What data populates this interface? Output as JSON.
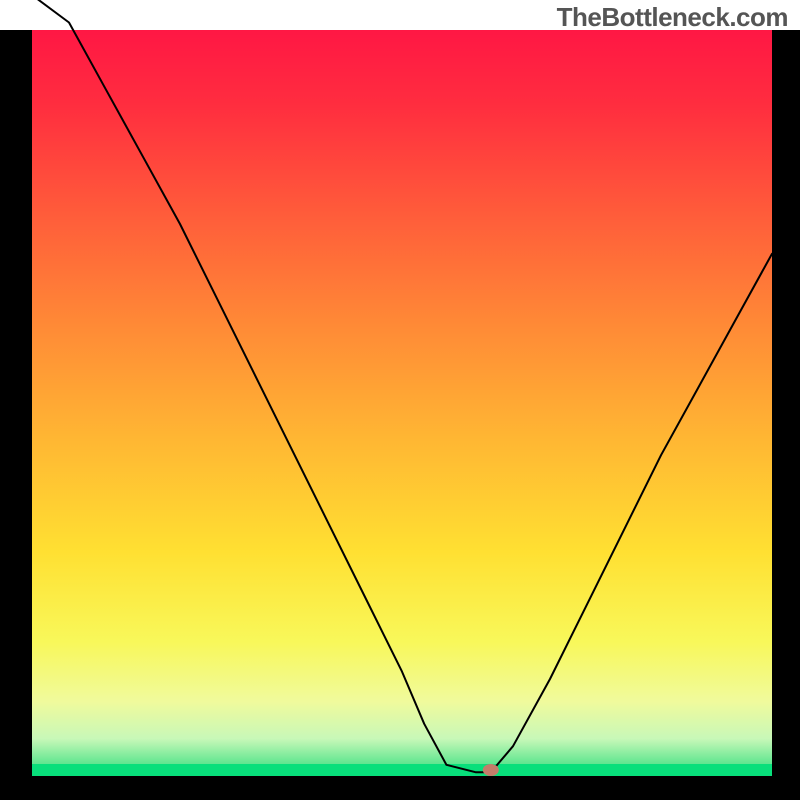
{
  "watermark": "TheBottleneck.com",
  "chart_data": {
    "type": "line",
    "title": "",
    "xlabel": "",
    "ylabel": "",
    "xlim": [
      0,
      100
    ],
    "ylim": [
      0,
      100
    ],
    "grid": false,
    "legend": false,
    "background": {
      "type": "vertical-gradient",
      "description": "heatmap gradient from red (top) through orange, yellow, to green (bottom) with a solid green strip at the very bottom",
      "stops": [
        {
          "offset": 0.0,
          "color": "#ff1744"
        },
        {
          "offset": 0.1,
          "color": "#ff2d3f"
        },
        {
          "offset": 0.25,
          "color": "#ff5d3a"
        },
        {
          "offset": 0.4,
          "color": "#ff8b36"
        },
        {
          "offset": 0.55,
          "color": "#ffb733"
        },
        {
          "offset": 0.7,
          "color": "#ffe032"
        },
        {
          "offset": 0.82,
          "color": "#f8f85a"
        },
        {
          "offset": 0.9,
          "color": "#f0fa9c"
        },
        {
          "offset": 0.95,
          "color": "#c8f8b8"
        },
        {
          "offset": 0.985,
          "color": "#5be58e"
        },
        {
          "offset": 1.0,
          "color": "#08df7b"
        }
      ]
    },
    "series": [
      {
        "name": "bottleneck-curve",
        "color": "#000000",
        "stroke_width": 2,
        "x": [
          0,
          5,
          10,
          15,
          20,
          25,
          30,
          35,
          40,
          45,
          50,
          53,
          56,
          60,
          62,
          65,
          70,
          75,
          80,
          85,
          90,
          95,
          100
        ],
        "y": [
          110,
          101,
          92,
          83,
          74,
          64,
          54,
          44,
          34,
          24,
          14,
          7,
          1.5,
          0.5,
          0.5,
          4,
          13,
          23,
          33,
          43,
          52,
          61,
          70
        ]
      }
    ],
    "marker": {
      "x": 62,
      "y": 0.8,
      "color": "#c37d6a",
      "rx": 8,
      "ry": 6
    },
    "frame": {
      "color": "#000000",
      "left_width": 32,
      "right_width": 28,
      "bottom_width": 24,
      "top_width": 0
    }
  }
}
